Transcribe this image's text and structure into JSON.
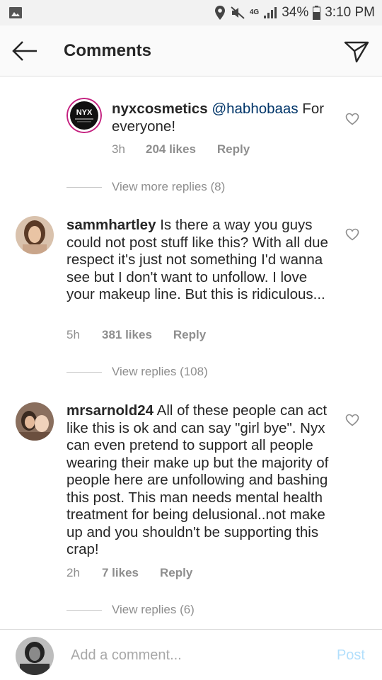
{
  "status_bar": {
    "network_label": "4G",
    "battery": "34%",
    "time": "3:10 PM"
  },
  "header": {
    "title": "Comments"
  },
  "comments": [
    {
      "username": "nyxcosmetics",
      "mention": "@habhobaas",
      "text": "For everyone!",
      "avatar_label": "NYX",
      "time": "3h",
      "likes": "204 likes",
      "reply_label": "Reply",
      "view_replies": "View more replies (8)"
    },
    {
      "username": "sammhartley",
      "text": "Is there a way you guys could not post stuff like this? With all due respect it's just not something I'd wanna see but I don't want to unfollow. I love your makeup line. But this is ridiculous...",
      "time": "5h",
      "likes": "381 likes",
      "reply_label": "Reply",
      "view_replies": "View replies (108)"
    },
    {
      "username": "mrsarnold24",
      "text": "All of these people can act like this is ok and can say \"girl bye\". Nyx can even pretend to support all people wearing their make up but the majority of people here are unfollowing and bashing this post. This man needs mental health treatment for being delusional..not make up and you shouldn't be supporting this crap!",
      "time": "2h",
      "likes": "7 likes",
      "reply_label": "Reply",
      "view_replies": "View replies (6)"
    }
  ],
  "footer": {
    "placeholder": "Add a comment...",
    "post_label": "Post"
  },
  "colors": {
    "text": "#262626",
    "secondary": "#8e8e8e",
    "mention": "#003569",
    "post_disabled": "#b2dffc"
  }
}
